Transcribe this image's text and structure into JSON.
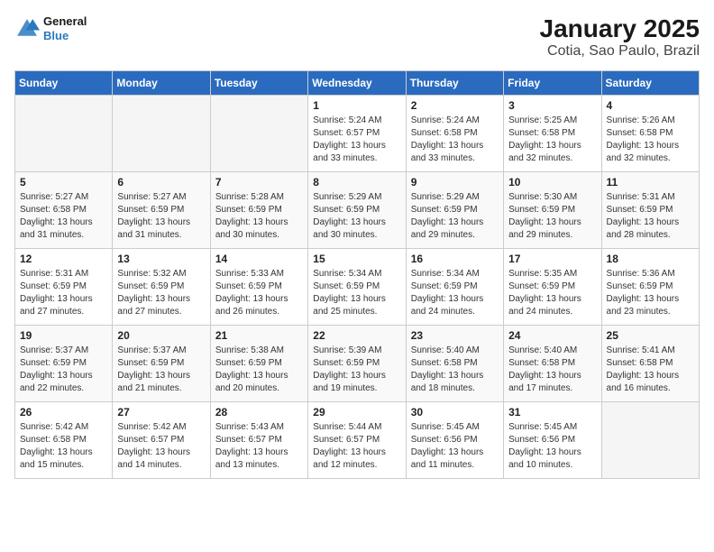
{
  "header": {
    "logo_line1": "General",
    "logo_line2": "Blue",
    "title": "January 2025",
    "subtitle": "Cotia, Sao Paulo, Brazil"
  },
  "days_of_week": [
    "Sunday",
    "Monday",
    "Tuesday",
    "Wednesday",
    "Thursday",
    "Friday",
    "Saturday"
  ],
  "weeks": [
    [
      {
        "day": "",
        "empty": true
      },
      {
        "day": "",
        "empty": true
      },
      {
        "day": "",
        "empty": true
      },
      {
        "day": "1",
        "sunrise": "5:24 AM",
        "sunset": "6:57 PM",
        "daylight": "13 hours and 33 minutes."
      },
      {
        "day": "2",
        "sunrise": "5:24 AM",
        "sunset": "6:58 PM",
        "daylight": "13 hours and 33 minutes."
      },
      {
        "day": "3",
        "sunrise": "5:25 AM",
        "sunset": "6:58 PM",
        "daylight": "13 hours and 32 minutes."
      },
      {
        "day": "4",
        "sunrise": "5:26 AM",
        "sunset": "6:58 PM",
        "daylight": "13 hours and 32 minutes."
      }
    ],
    [
      {
        "day": "5",
        "sunrise": "5:27 AM",
        "sunset": "6:58 PM",
        "daylight": "13 hours and 31 minutes."
      },
      {
        "day": "6",
        "sunrise": "5:27 AM",
        "sunset": "6:59 PM",
        "daylight": "13 hours and 31 minutes."
      },
      {
        "day": "7",
        "sunrise": "5:28 AM",
        "sunset": "6:59 PM",
        "daylight": "13 hours and 30 minutes."
      },
      {
        "day": "8",
        "sunrise": "5:29 AM",
        "sunset": "6:59 PM",
        "daylight": "13 hours and 30 minutes."
      },
      {
        "day": "9",
        "sunrise": "5:29 AM",
        "sunset": "6:59 PM",
        "daylight": "13 hours and 29 minutes."
      },
      {
        "day": "10",
        "sunrise": "5:30 AM",
        "sunset": "6:59 PM",
        "daylight": "13 hours and 29 minutes."
      },
      {
        "day": "11",
        "sunrise": "5:31 AM",
        "sunset": "6:59 PM",
        "daylight": "13 hours and 28 minutes."
      }
    ],
    [
      {
        "day": "12",
        "sunrise": "5:31 AM",
        "sunset": "6:59 PM",
        "daylight": "13 hours and 27 minutes."
      },
      {
        "day": "13",
        "sunrise": "5:32 AM",
        "sunset": "6:59 PM",
        "daylight": "13 hours and 27 minutes."
      },
      {
        "day": "14",
        "sunrise": "5:33 AM",
        "sunset": "6:59 PM",
        "daylight": "13 hours and 26 minutes."
      },
      {
        "day": "15",
        "sunrise": "5:34 AM",
        "sunset": "6:59 PM",
        "daylight": "13 hours and 25 minutes."
      },
      {
        "day": "16",
        "sunrise": "5:34 AM",
        "sunset": "6:59 PM",
        "daylight": "13 hours and 24 minutes."
      },
      {
        "day": "17",
        "sunrise": "5:35 AM",
        "sunset": "6:59 PM",
        "daylight": "13 hours and 24 minutes."
      },
      {
        "day": "18",
        "sunrise": "5:36 AM",
        "sunset": "6:59 PM",
        "daylight": "13 hours and 23 minutes."
      }
    ],
    [
      {
        "day": "19",
        "sunrise": "5:37 AM",
        "sunset": "6:59 PM",
        "daylight": "13 hours and 22 minutes."
      },
      {
        "day": "20",
        "sunrise": "5:37 AM",
        "sunset": "6:59 PM",
        "daylight": "13 hours and 21 minutes."
      },
      {
        "day": "21",
        "sunrise": "5:38 AM",
        "sunset": "6:59 PM",
        "daylight": "13 hours and 20 minutes."
      },
      {
        "day": "22",
        "sunrise": "5:39 AM",
        "sunset": "6:59 PM",
        "daylight": "13 hours and 19 minutes."
      },
      {
        "day": "23",
        "sunrise": "5:40 AM",
        "sunset": "6:58 PM",
        "daylight": "13 hours and 18 minutes."
      },
      {
        "day": "24",
        "sunrise": "5:40 AM",
        "sunset": "6:58 PM",
        "daylight": "13 hours and 17 minutes."
      },
      {
        "day": "25",
        "sunrise": "5:41 AM",
        "sunset": "6:58 PM",
        "daylight": "13 hours and 16 minutes."
      }
    ],
    [
      {
        "day": "26",
        "sunrise": "5:42 AM",
        "sunset": "6:58 PM",
        "daylight": "13 hours and 15 minutes."
      },
      {
        "day": "27",
        "sunrise": "5:42 AM",
        "sunset": "6:57 PM",
        "daylight": "13 hours and 14 minutes."
      },
      {
        "day": "28",
        "sunrise": "5:43 AM",
        "sunset": "6:57 PM",
        "daylight": "13 hours and 13 minutes."
      },
      {
        "day": "29",
        "sunrise": "5:44 AM",
        "sunset": "6:57 PM",
        "daylight": "13 hours and 12 minutes."
      },
      {
        "day": "30",
        "sunrise": "5:45 AM",
        "sunset": "6:56 PM",
        "daylight": "13 hours and 11 minutes."
      },
      {
        "day": "31",
        "sunrise": "5:45 AM",
        "sunset": "6:56 PM",
        "daylight": "13 hours and 10 minutes."
      },
      {
        "day": "",
        "empty": true
      }
    ]
  ],
  "labels": {
    "sunrise": "Sunrise:",
    "sunset": "Sunset:",
    "daylight": "Daylight:"
  }
}
